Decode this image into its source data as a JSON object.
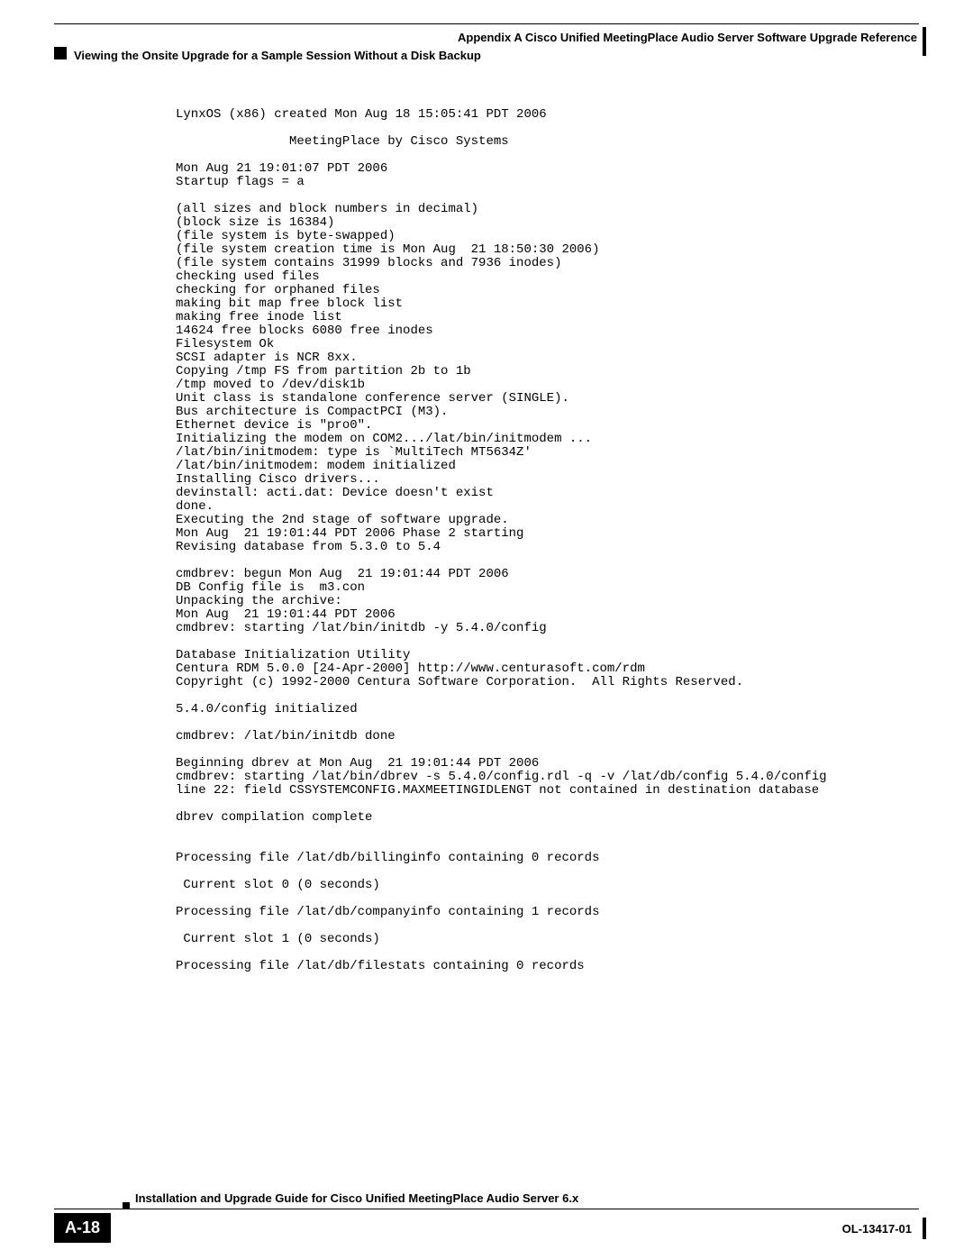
{
  "header": {
    "right": "Appendix A      Cisco Unified MeetingPlace Audio Server Software Upgrade Reference",
    "left": "Viewing the Onsite Upgrade for a Sample Session Without a Disk Backup"
  },
  "content": "LynxOS (x86) created Mon Aug 18 15:05:41 PDT 2006\n\n               MeetingPlace by Cisco Systems\n\nMon Aug 21 19:01:07 PDT 2006\nStartup flags = a\n\n(all sizes and block numbers in decimal)\n(block size is 16384)\n(file system is byte-swapped)\n(file system creation time is Mon Aug  21 18:50:30 2006)\n(file system contains 31999 blocks and 7936 inodes)\nchecking used files\nchecking for orphaned files\nmaking bit map free block list\nmaking free inode list\n14624 free blocks 6080 free inodes\nFilesystem Ok\nSCSI adapter is NCR 8xx.\nCopying /tmp FS from partition 2b to 1b\n/tmp moved to /dev/disk1b\nUnit class is standalone conference server (SINGLE).\nBus architecture is CompactPCI (M3).\nEthernet device is \"pro0\".\nInitializing the modem on COM2.../lat/bin/initmodem ...\n/lat/bin/initmodem: type is `MultiTech MT5634Z'\n/lat/bin/initmodem: modem initialized\nInstalling Cisco drivers...\ndevinstall: acti.dat: Device doesn't exist\ndone.\nExecuting the 2nd stage of software upgrade.\nMon Aug  21 19:01:44 PDT 2006 Phase 2 starting\nRevising database from 5.3.0 to 5.4\n\ncmdbrev: begun Mon Aug  21 19:01:44 PDT 2006\nDB Config file is  m3.con\nUnpacking the archive:\nMon Aug  21 19:01:44 PDT 2006\ncmdbrev: starting /lat/bin/initdb -y 5.4.0/config\n\nDatabase Initialization Utility\nCentura RDM 5.0.0 [24-Apr-2000] http://www.centurasoft.com/rdm\nCopyright (c) 1992-2000 Centura Software Corporation.  All Rights Reserved.\n\n5.4.0/config initialized\n\ncmdbrev: /lat/bin/initdb done\n\nBeginning dbrev at Mon Aug  21 19:01:44 PDT 2006\ncmdbrev: starting /lat/bin/dbrev -s 5.4.0/config.rdl -q -v /lat/db/config 5.4.0/config\nline 22: field CSSYSTEMCONFIG.MAXMEETINGIDLENGT not contained in destination database\n\ndbrev compilation complete\n\n\nProcessing file /lat/db/billinginfo containing 0 records\n\n Current slot 0 (0 seconds)\n\nProcessing file /lat/db/companyinfo containing 1 records\n\n Current slot 1 (0 seconds)\n\nProcessing file /lat/db/filestats containing 0 records",
  "footer": {
    "title": "Installation and Upgrade Guide for Cisco Unified MeetingPlace Audio Server 6.x",
    "page_num": "A-18",
    "doc_id": "OL-13417-01"
  }
}
